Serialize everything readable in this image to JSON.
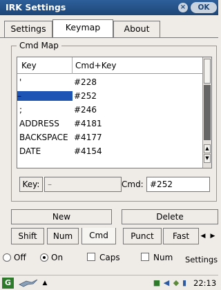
{
  "window": {
    "title": "IRK Settings",
    "ok_label": "OK",
    "close_glyph": "×"
  },
  "tabs": [
    {
      "label": "Settings"
    },
    {
      "label": "Keymap"
    },
    {
      "label": "About"
    }
  ],
  "cmd_map": {
    "legend": "Cmd Map",
    "columns": [
      "Key",
      "Cmd+Key"
    ],
    "rows": [
      {
        "key": "'",
        "cmd": "#228"
      },
      {
        "key": "–",
        "cmd": "#252"
      },
      {
        "key": ";",
        "cmd": "#246"
      },
      {
        "key": "ADDRESS",
        "cmd": "#4181"
      },
      {
        "key": "BACKSPACE",
        "cmd": "#4177"
      },
      {
        "key": "DATE",
        "cmd": "#4154"
      }
    ],
    "selected_index": 1
  },
  "fields": {
    "key_label": "Key:",
    "key_value": "–",
    "cmd_label": "Cmd:",
    "cmd_value": "#252"
  },
  "actions": {
    "new_label": "New",
    "delete_label": "Delete"
  },
  "keyboard_tabs": [
    {
      "label": "Shift"
    },
    {
      "label": "Num"
    },
    {
      "label": "Cmd"
    },
    {
      "label": "Punct"
    },
    {
      "label": "Fast"
    }
  ],
  "options": {
    "off_label": "Off",
    "on_label": "On",
    "caps_label": "Caps",
    "num_label": "Num",
    "settings_label": "Settings"
  },
  "taskbar": {
    "start_glyph": "G",
    "clock": "22:13"
  },
  "colors": {
    "titlebar": "#1d4677",
    "selection": "#1d55b5"
  }
}
